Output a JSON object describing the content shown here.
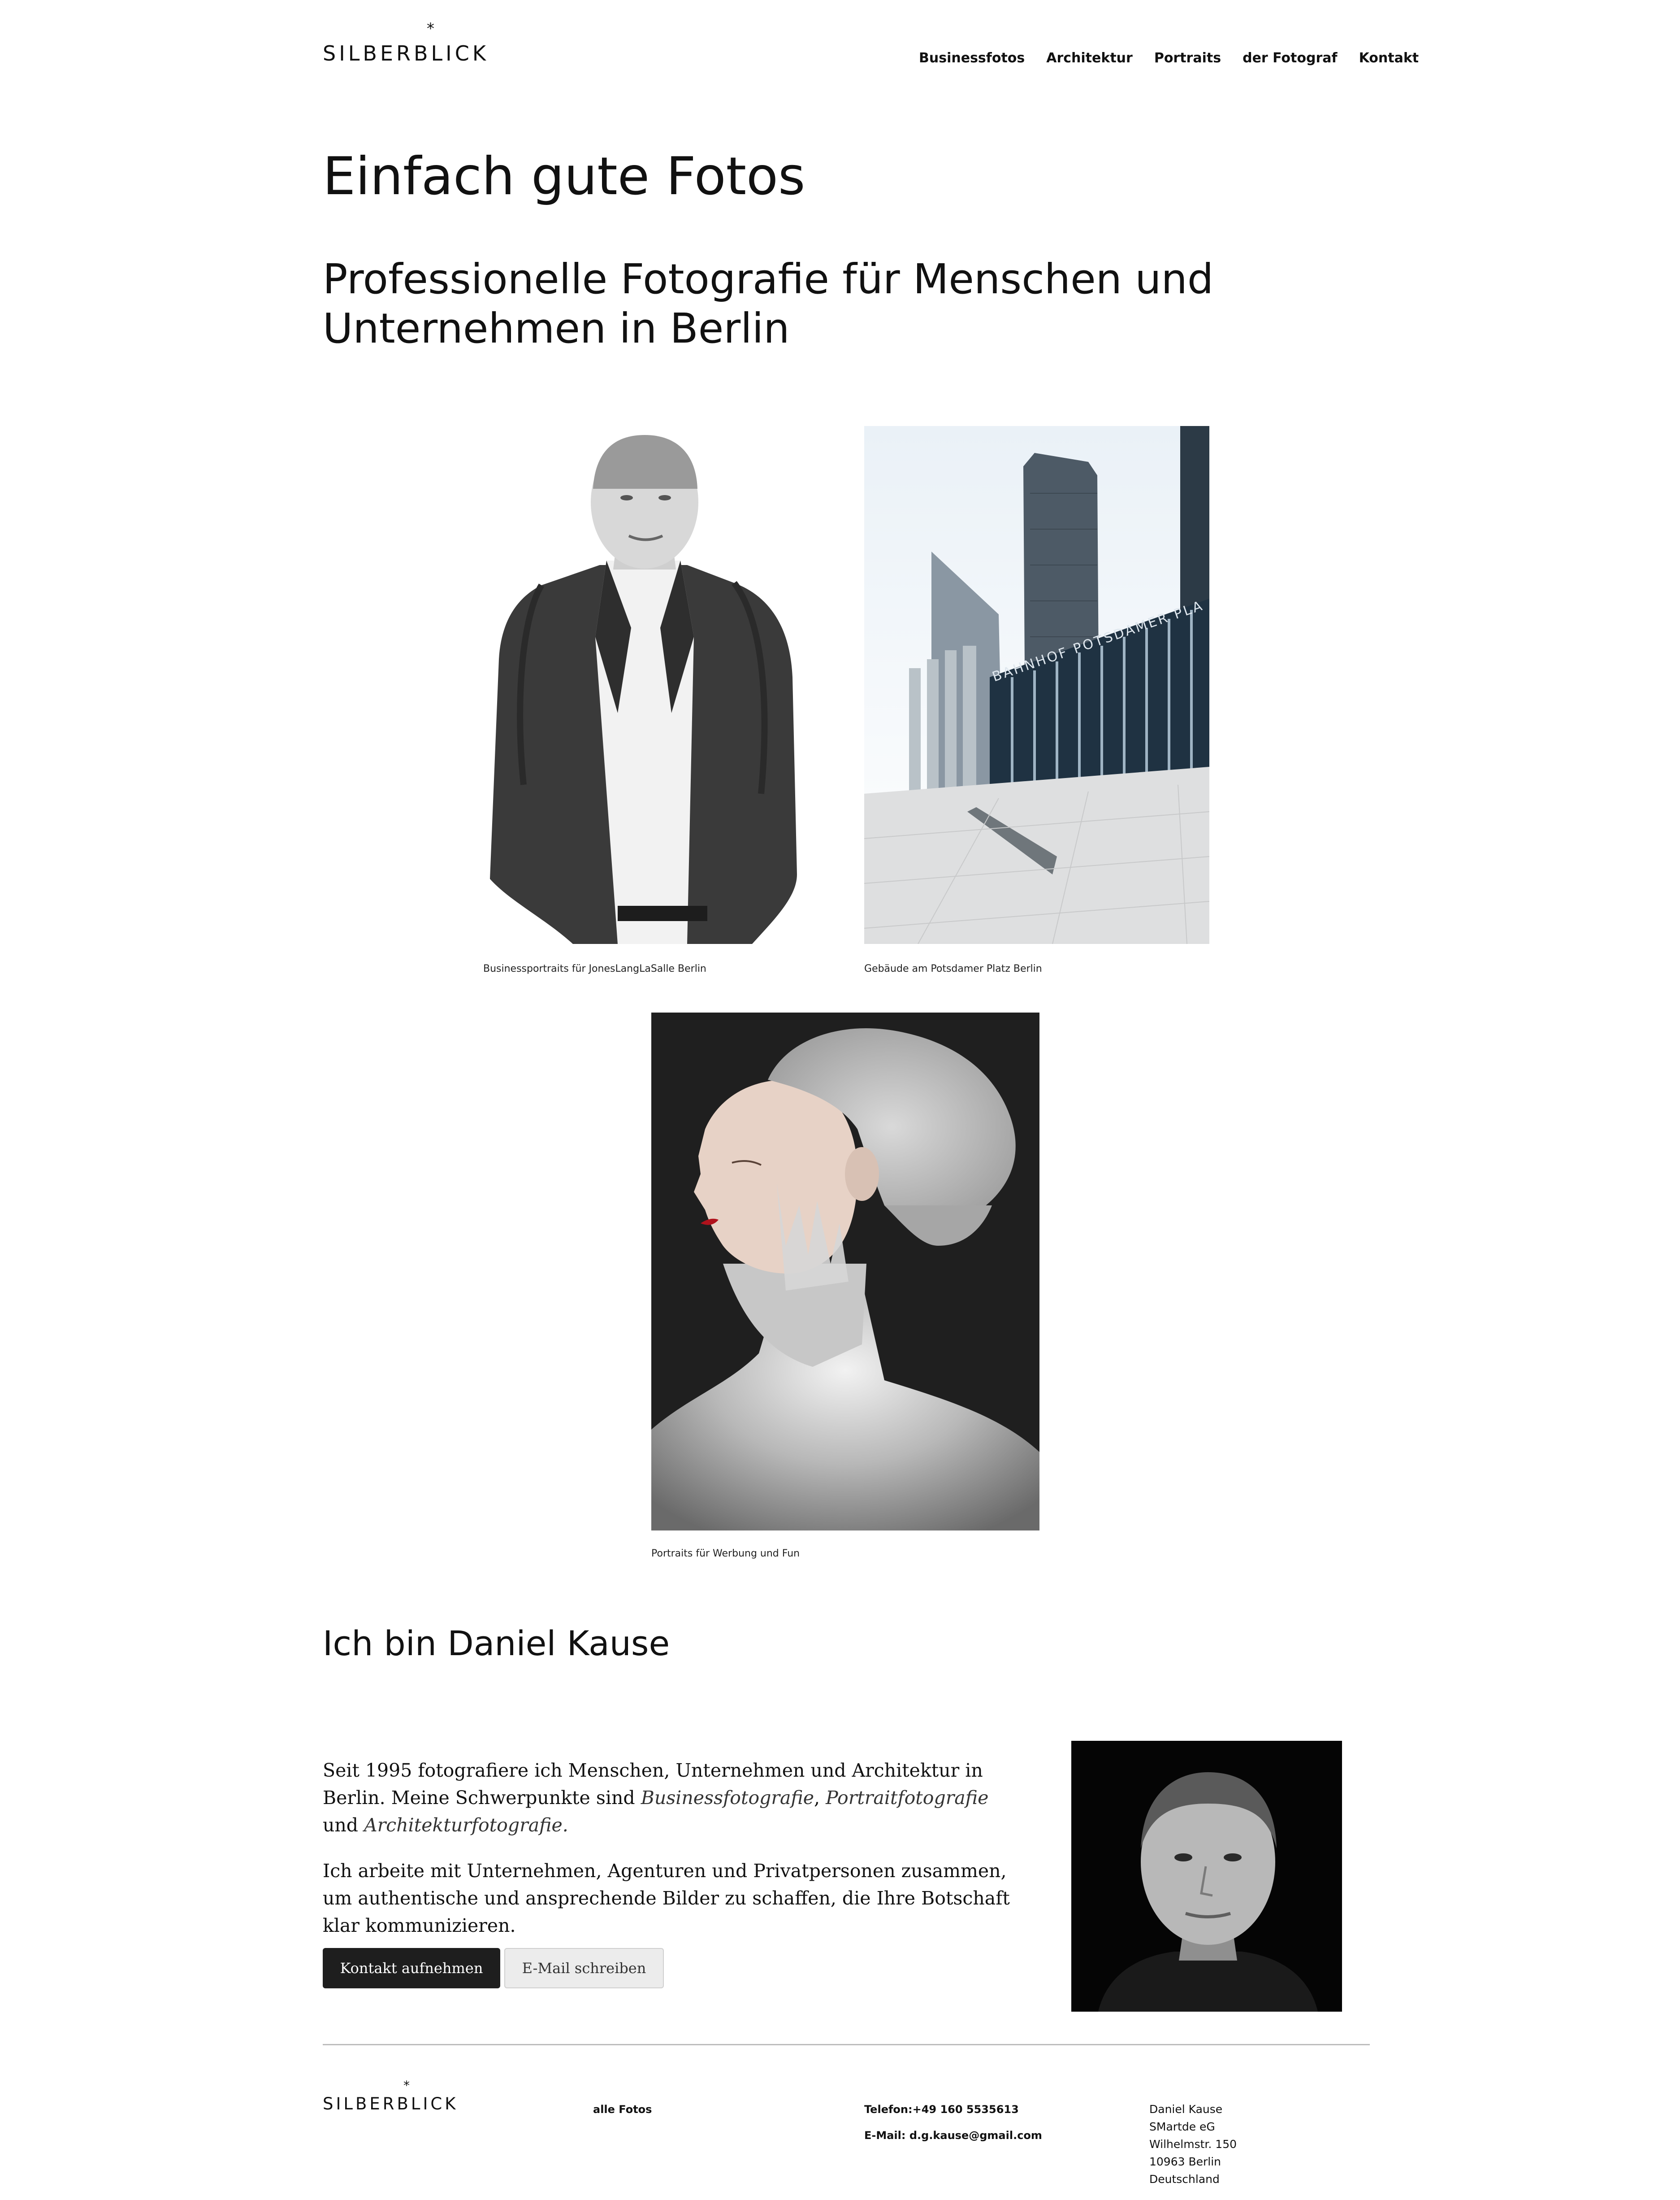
{
  "brand": {
    "name": "SILBERBLICK",
    "star": "*"
  },
  "nav": {
    "items": [
      "Businessfotos",
      "Architektur",
      "Portraits",
      "der Fotograf",
      "Kontakt"
    ]
  },
  "hero": {
    "title": "Einfach gute Fotos",
    "subtitle": "Professionelle Fotografie für Menschen und Unternehmen in Berlin"
  },
  "gallery": {
    "captions": [
      "Businessportraits für JonesLangLaSalle Berlin",
      "Gebäude am Potsdamer Platz Berlin",
      "Portraits für Werbung und Fun"
    ],
    "station_sign": "BAHNHOF POTSDAMER PLA"
  },
  "about": {
    "heading": "Ich bin Daniel Kause",
    "p1_start": "Seit 1995 fotografiere ich Menschen, Unternehmen und Architektur in Berlin. Meine Schwerpunkte sind ",
    "p1_em1": "Businessfotografie",
    "p1_sep": ", ",
    "p1_em2": "Portraitfotografie",
    "p1_and": " und ",
    "p1_em3": "Architekturfotografie.",
    "p2": "Ich arbeite mit Unternehmen, Agenturen und Privatpersonen zusammen, um authentische und ansprechende Bilder zu schaffen, die Ihre Botschaft klar kommunizieren.",
    "btn_contact": "Kontakt aufnehmen",
    "btn_email": "E-Mail schreiben"
  },
  "footer": {
    "all_photos": "alle Fotos",
    "phone": "Telefon:+49 160 5535613",
    "email": "E-Mail: d.g.kause@gmail.com",
    "address": [
      "Daniel Kause",
      "SMartde eG",
      "Wilhelmstr. 150",
      "10963 Berlin",
      "Deutschland"
    ]
  }
}
